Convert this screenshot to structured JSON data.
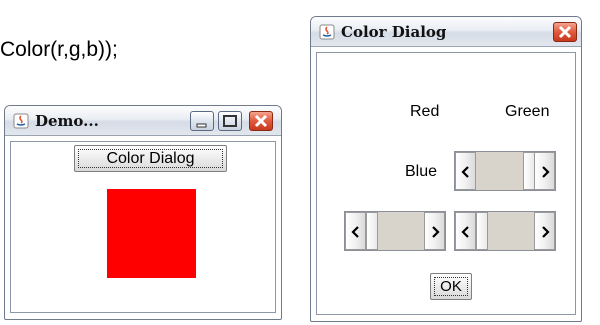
{
  "code_snippet": "Color(r,g,b));",
  "demo_window": {
    "title": "Demo...",
    "color_dialog_button": "Color Dialog",
    "swatch_color": "#ff0000"
  },
  "color_dialog": {
    "title": "Color Dialog",
    "labels": {
      "red": "Red",
      "green": "Green",
      "blue": "Blue"
    },
    "ok_button": "OK"
  },
  "icons": [
    "java-icon",
    "minimize-icon",
    "maximize-icon",
    "close-icon",
    "left-arrow-icon",
    "right-arrow-icon"
  ],
  "colors": {
    "close_button": "#e05a3c",
    "scrollbar_track": "#d8d4cc"
  }
}
